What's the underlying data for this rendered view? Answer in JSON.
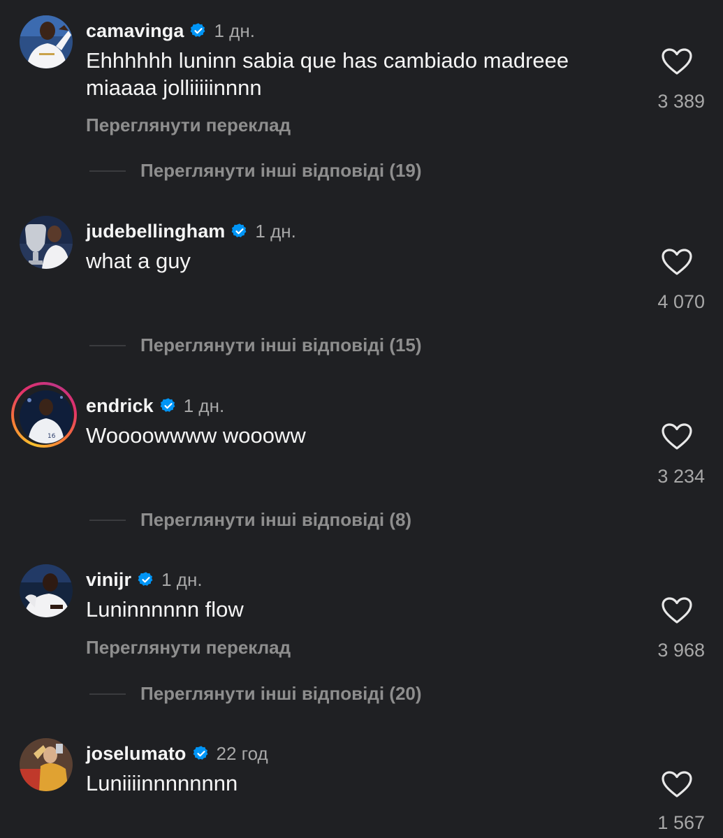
{
  "colors": {
    "background": "#1f2023",
    "verified": "#0095f6",
    "muted": "#8e8e8e"
  },
  "comments": [
    {
      "username": "camavinga",
      "time": "1 дн.",
      "text": "Ehhhhhh luninn sabia que has cambiado madreee miaaaa jolliiiiinnnn",
      "translate_label": "Переглянути переклад",
      "likes": "3 389",
      "replies_label": "Переглянути інші відповіді (19)"
    },
    {
      "username": "judebellingham",
      "time": "1 дн.",
      "text": "what a guy",
      "likes": "4 070",
      "replies_label": "Переглянути інші відповіді (15)"
    },
    {
      "username": "endrick",
      "time": "1 дн.",
      "text": "Woooowwww woooww",
      "likes": "3 234",
      "replies_label": "Переглянути інші відповіді (8)"
    },
    {
      "username": "vinijr",
      "time": "1 дн.",
      "text": "Luninnnnnn flow",
      "translate_label": "Переглянути переклад",
      "likes": "3 968",
      "replies_label": "Переглянути інші відповіді (20)"
    },
    {
      "username": "joselumato",
      "time": "22 год",
      "text": "Luniiiinnnnnnnn",
      "likes": "1 567"
    }
  ],
  "icons": {
    "verified": "verified-badge-icon",
    "like": "heart-outline-icon"
  }
}
